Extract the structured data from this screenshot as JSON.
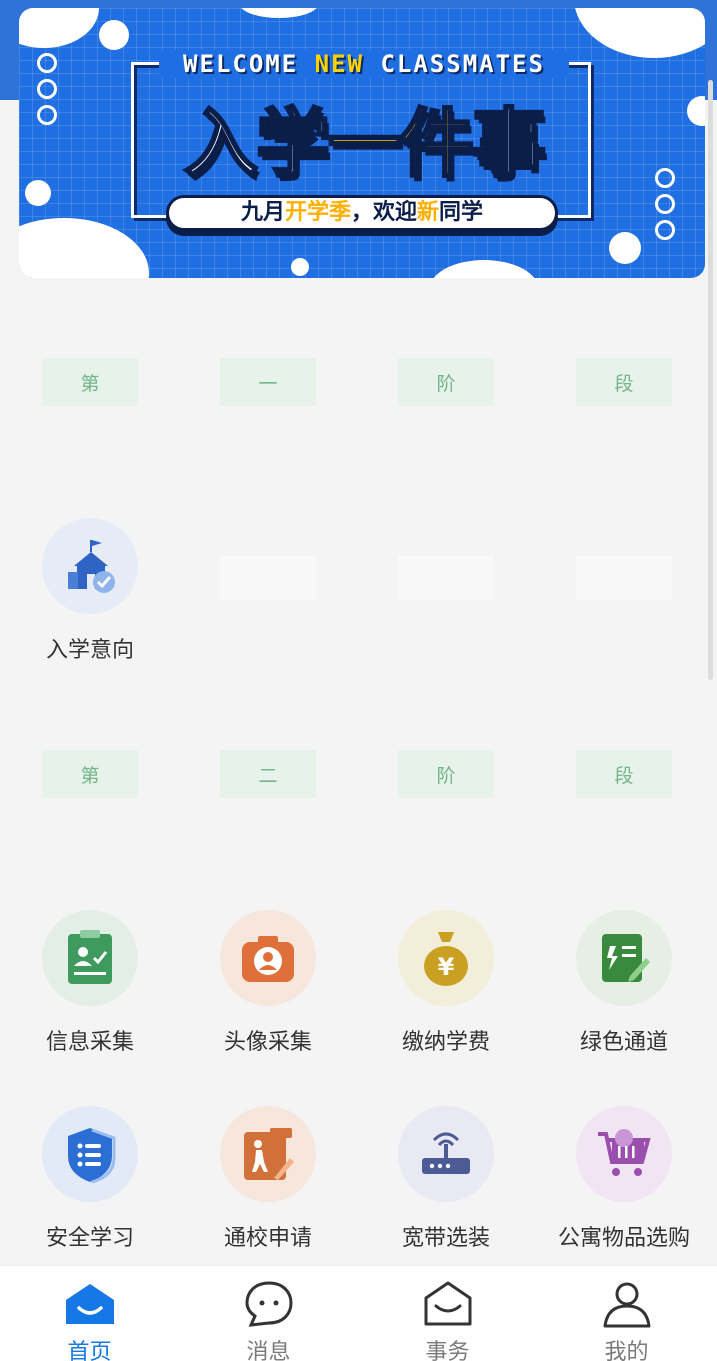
{
  "banner": {
    "welcome_pre": "WELCOME ",
    "welcome_hl": "NEW",
    "welcome_post": " CLASSMATES",
    "title_pre": "入学",
    "title_hl": "一件",
    "title_post": "事",
    "subtitle_pre": "九月",
    "subtitle_hl": "开学季",
    "subtitle_mid": "，欢迎",
    "subtitle_hl2": "新",
    "subtitle_post": "同学"
  },
  "stage1": {
    "chars": [
      "第",
      "一",
      "阶",
      "段"
    ]
  },
  "stage2": {
    "chars": [
      "第",
      "二",
      "阶",
      "段"
    ]
  },
  "stage1_items": [
    {
      "label": "入学意向",
      "icon": "school-check-icon"
    }
  ],
  "stage2_items": [
    {
      "label": "信息采集",
      "icon": "clipboard-user-icon",
      "color": "#3e9a5d"
    },
    {
      "label": "头像采集",
      "icon": "camera-portrait-icon",
      "color": "#e0703a"
    },
    {
      "label": "缴纳学费",
      "icon": "money-bag-icon",
      "color": "#c9a021"
    },
    {
      "label": "绿色通道",
      "icon": "green-channel-icon",
      "color": "#3a8a3e"
    },
    {
      "label": "安全学习",
      "icon": "shield-list-icon",
      "color": "#2c6fd4"
    },
    {
      "label": "通校申请",
      "icon": "walk-to-school-icon",
      "color": "#d2703a"
    },
    {
      "label": "宽带选装",
      "icon": "router-icon",
      "color": "#4d5b95"
    },
    {
      "label": "公寓物品选购",
      "icon": "shopping-cart-icon",
      "color": "#9a4fae"
    }
  ],
  "tabbar": {
    "accent": "#1677e6",
    "tabs": [
      {
        "label": "首页",
        "icon": "home-smile-icon",
        "active": true
      },
      {
        "label": "消息",
        "icon": "chat-bubble-icon",
        "active": false
      },
      {
        "label": "事务",
        "icon": "envelope-icon",
        "active": false
      },
      {
        "label": "我的",
        "icon": "user-icon",
        "active": false
      }
    ]
  }
}
